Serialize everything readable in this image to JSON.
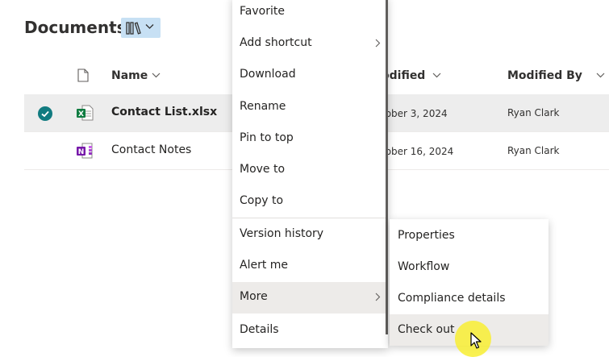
{
  "library": {
    "title": "Documents",
    "view_icon": "library-icon"
  },
  "columns": {
    "icon_col": "document-icon",
    "name": "Name",
    "modified": "odified",
    "modified_by": "Modified By"
  },
  "rows": [
    {
      "name": "Contact List.xlsx",
      "date": "tober 3, 2024",
      "by": "Ryan Clark",
      "icon": "excel-icon",
      "selected": true
    },
    {
      "name": "Contact Notes",
      "date": "tober 16, 2024",
      "by": "Ryan Clark",
      "icon": "onenote-icon",
      "selected": false
    }
  ],
  "menu": {
    "items": [
      {
        "label": "Favorite"
      },
      {
        "label": "Add shortcut",
        "submenu": true
      },
      {
        "label": "Download"
      },
      {
        "label": "Rename"
      },
      {
        "label": "Pin to top"
      },
      {
        "label": "Move to"
      },
      {
        "label": "Copy to"
      },
      {
        "label": "Version history"
      },
      {
        "label": "Alert me"
      },
      {
        "label": "More",
        "submenu": true,
        "hovered": true
      },
      {
        "label": "Details"
      }
    ]
  },
  "submenu": {
    "items": [
      {
        "label": "Properties"
      },
      {
        "label": "Workflow"
      },
      {
        "label": "Compliance details"
      },
      {
        "label": "Check out",
        "hovered": true
      }
    ]
  },
  "colors": {
    "accent": "#117b80",
    "excel": "#107c41",
    "onenote": "#7719aa",
    "view_button_bg": "#c7e0f4"
  }
}
